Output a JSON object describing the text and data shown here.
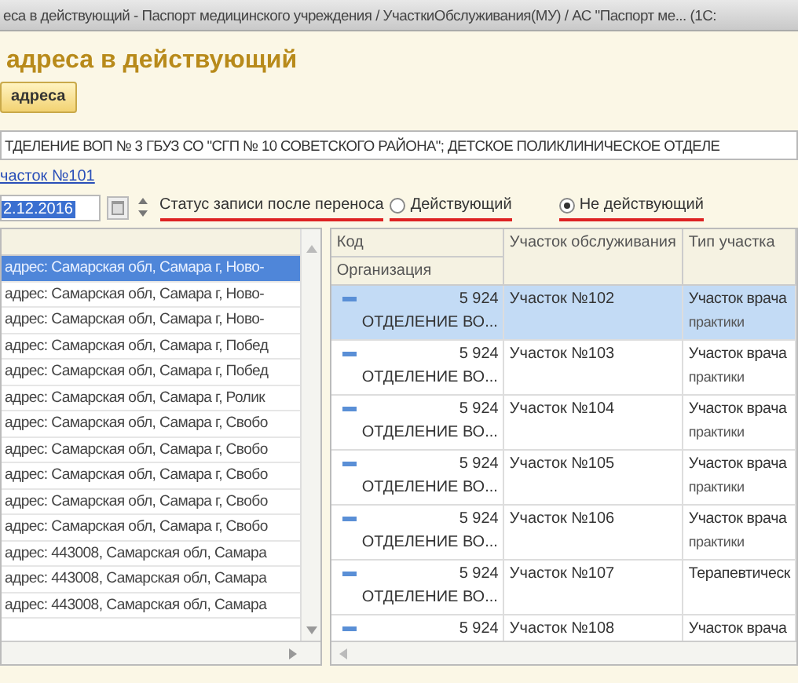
{
  "window": {
    "title": "еса в действующий - Паспорт медицинского учреждения / УчасткиОбслуживания(МУ) / АС \"Паспорт ме... (1С:"
  },
  "form_title": "адреса в действующий",
  "toolbar": {
    "button": "адреса"
  },
  "organization_field": {
    "value": "ТДЕЛЕНИЕ ВОП № 3 ГБУЗ СО \"СГП № 10 СОВЕТСКОГО РАЙОНА\"; ДЕТСКОЕ ПОЛИКЛИНИЧЕСКОЕ ОТДЕЛЕ"
  },
  "district_link": "часток №101",
  "transfer_row": {
    "date": "2.12.2016",
    "status_label": "Статус записи после переноса",
    "options": [
      {
        "label": "Действующий",
        "selected": false
      },
      {
        "label": "Не действующий",
        "selected": true
      }
    ]
  },
  "addresses": {
    "rows": [
      {
        "text": "адрес: Самарская обл, Самара г, Ново-",
        "selected": true
      },
      {
        "text": "адрес: Самарская обл, Самара г, Ново-",
        "selected": false
      },
      {
        "text": "адрес: Самарская обл, Самара г, Ново-",
        "selected": false
      },
      {
        "text": "адрес: Самарская обл, Самара г, Побед",
        "selected": false
      },
      {
        "text": "адрес: Самарская обл, Самара г, Побед",
        "selected": false
      },
      {
        "text": "адрес: Самарская обл, Самара г, Ролик",
        "selected": false
      },
      {
        "text": "адрес: Самарская обл, Самара г, Свобо",
        "selected": false
      },
      {
        "text": "адрес: Самарская обл, Самара г, Свобо",
        "selected": false
      },
      {
        "text": "адрес: Самарская обл, Самара г, Свобо",
        "selected": false
      },
      {
        "text": "адрес: Самарская обл, Самара г, Свобо",
        "selected": false
      },
      {
        "text": "адрес: Самарская обл, Самара г, Свобо",
        "selected": false
      },
      {
        "text": "адрес: 443008, Самарская обл, Самара",
        "selected": false
      },
      {
        "text": "адрес: 443008, Самарская обл, Самара",
        "selected": false
      },
      {
        "text": "адрес: 443008, Самарская обл, Самара",
        "selected": false
      }
    ]
  },
  "districts": {
    "columns": [
      "Код",
      "Организация",
      "Участок обслуживания",
      "Тип участка"
    ],
    "rows": [
      {
        "code": "5 924",
        "organization": "ОТДЕЛЕНИЕ ВО...",
        "district": "Участок №102",
        "type_lines": [
          "Участок врача",
          "практики"
        ],
        "selected": true
      },
      {
        "code": "5 924",
        "organization": "ОТДЕЛЕНИЕ ВО...",
        "district": "Участок №103",
        "type_lines": [
          "Участок врача",
          "практики"
        ],
        "selected": false
      },
      {
        "code": "5 924",
        "organization": "ОТДЕЛЕНИЕ ВО...",
        "district": "Участок №104",
        "type_lines": [
          "Участок врача",
          "практики"
        ],
        "selected": false
      },
      {
        "code": "5 924",
        "organization": "ОТДЕЛЕНИЕ ВО...",
        "district": "Участок №105",
        "type_lines": [
          "Участок врача",
          "практики"
        ],
        "selected": false
      },
      {
        "code": "5 924",
        "organization": "ОТДЕЛЕНИЕ ВО...",
        "district": "Участок №106",
        "type_lines": [
          "Участок врача",
          "практики"
        ],
        "selected": false
      },
      {
        "code": "5 924",
        "organization": "ОТДЕЛЕНИЕ ВО...",
        "district": "Участок №107",
        "type_lines": [
          "Терапевтическ"
        ],
        "selected": false
      },
      {
        "code": "5 924",
        "district": "Участок №108",
        "type_lines": [
          "Участок врача"
        ],
        "selected": false
      }
    ]
  }
}
